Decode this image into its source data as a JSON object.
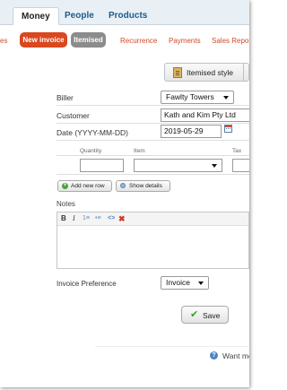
{
  "top_tabs": {
    "money": "Money",
    "people": "People",
    "products": "Products"
  },
  "sub_nav": {
    "partial_left": "es",
    "new_invoice": "New invoice",
    "itemised": "Itemised",
    "recurrence": "Recurrence",
    "payments": "Payments",
    "sales_reports": "Sales Reports"
  },
  "style_toggle": {
    "label": "Itemised style",
    "icon": "itemised-document-icon"
  },
  "form": {
    "biller": {
      "label": "Biller",
      "value": "Fawlty Towers"
    },
    "customer": {
      "label": "Customer",
      "value": "Kath and Kim Pty Ltd"
    },
    "date": {
      "label": "Date (YYYY-MM-DD)",
      "value": "2019-05-29",
      "icon": "calendar-icon"
    }
  },
  "line_items": {
    "columns": [
      "Quantity",
      "Item",
      "Tax"
    ],
    "rows": [
      {
        "quantity": "",
        "item": "",
        "tax": ""
      }
    ]
  },
  "actions": {
    "add_new_row": "Add new row",
    "show_details": "Show details"
  },
  "notes": {
    "label": "Notes",
    "toolbar": {
      "bold": "B",
      "italic": "I",
      "ordered_list_icon": "ordered-list-icon",
      "unordered_list_icon": "unordered-list-icon",
      "code_icon": "code-icon",
      "clear_icon": "clear-format-icon"
    },
    "content": ""
  },
  "invoice_preference": {
    "label": "Invoice Preference",
    "value": "Invoice"
  },
  "save": {
    "label": "Save"
  },
  "help": {
    "text": "Want mo"
  },
  "colors": {
    "accent_red": "#d9481f",
    "pill_grey": "#8c8c8c",
    "link_orange": "#d04a26",
    "nav_blue": "#1e5a8a",
    "save_green": "#3a9b32"
  }
}
